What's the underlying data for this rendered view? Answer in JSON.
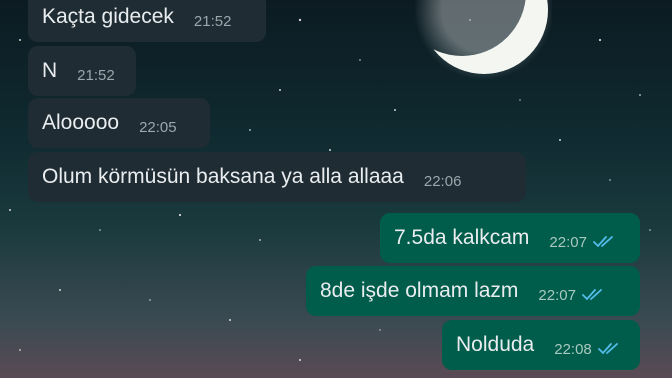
{
  "conversation": {
    "messages": [
      {
        "direction": "in",
        "text": "Kaçta gidecek",
        "time": "21:52"
      },
      {
        "direction": "in",
        "text": "N",
        "time": "21:52"
      },
      {
        "direction": "in",
        "text": "Alooooo",
        "time": "22:05"
      },
      {
        "direction": "in",
        "text": "Olum körmüsün baksana ya alla allaaa",
        "time": "22:06"
      },
      {
        "direction": "out",
        "text": "7.5da kalkcam",
        "time": "22:07",
        "status": "read"
      },
      {
        "direction": "out",
        "text": "8de işde olmam lazm",
        "time": "22:07",
        "status": "read"
      },
      {
        "direction": "out",
        "text": "Nolduda",
        "time": "22:08",
        "status": "read"
      }
    ]
  },
  "colors": {
    "incoming_bubble": "#1f2c33",
    "outgoing_bubble": "#005c4b",
    "read_ticks": "#53bdeb"
  }
}
